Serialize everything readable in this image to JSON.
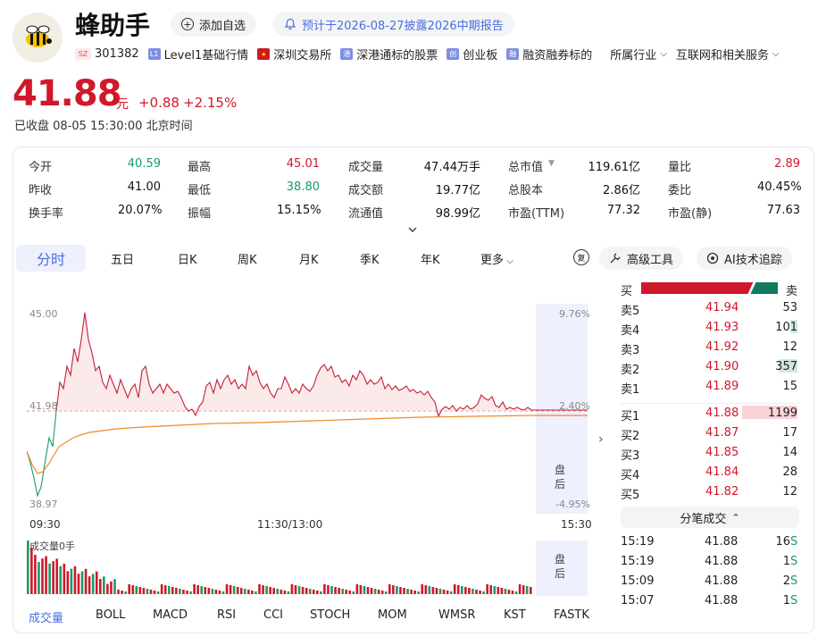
{
  "header": {
    "title": "蜂助手",
    "add_watchlist": "添加自选",
    "notice": "预计于2026-08-27披露2026中期报告"
  },
  "tags": {
    "market_badge": "SZ",
    "code": "301382",
    "l1_badge": "L1",
    "level1": "Level1基础行情",
    "exchange": "深圳交易所",
    "hk_connect_badge": "通",
    "hk_connect": "深港通标的股票",
    "chinext_badge": "创",
    "chinext": "创业板",
    "margin_badge": "融",
    "margin": "融资融券标的",
    "industry_label": "所属行业",
    "industry": "互联网和相关服务"
  },
  "price": {
    "value": "41.88",
    "unit": "元",
    "change": "+0.88",
    "percent": "+2.15%",
    "status": "已收盘",
    "time": "08-05 15:30:00 北京时间"
  },
  "quote": [
    [
      {
        "label": "今开",
        "value": "40.59",
        "color": "green"
      },
      {
        "label": "最高",
        "value": "45.01",
        "color": "red"
      },
      {
        "label": "成交量",
        "value": "47.44万手",
        "color": "blk"
      },
      {
        "label": "总市值",
        "value": "119.61亿",
        "color": "blk"
      },
      {
        "label": "量比",
        "value": "2.89",
        "color": "red"
      }
    ],
    [
      {
        "label": "昨收",
        "value": "41.00",
        "color": "blk"
      },
      {
        "label": "最低",
        "value": "38.80",
        "color": "green"
      },
      {
        "label": "成交额",
        "value": "19.77亿",
        "color": "blk"
      },
      {
        "label": "总股本",
        "value": "2.86亿",
        "color": "blk"
      },
      {
        "label": "委比",
        "value": "40.45%",
        "color": "blk"
      }
    ],
    [
      {
        "label": "换手率",
        "value": "20.07%",
        "color": "blk"
      },
      {
        "label": "振幅",
        "value": "15.15%",
        "color": "blk"
      },
      {
        "label": "流通值",
        "value": "98.99亿",
        "color": "blk"
      },
      {
        "label": "市盈(TTM)",
        "value": "77.32",
        "color": "blk"
      },
      {
        "label": "市盈(静)",
        "value": "77.63",
        "color": "blk"
      }
    ]
  ],
  "tabs": [
    "分时",
    "五日",
    "日K",
    "周K",
    "月K",
    "季K",
    "年K",
    "更多"
  ],
  "tools": {
    "advanced": "高级工具",
    "ai": "AI技术追踪"
  },
  "chart": {
    "y_top": "45.00",
    "y_mid": "41.98",
    "y_bot": "38.97",
    "pct_top": "9.76%",
    "pct_mid": "2.40%",
    "pct_bot": "-4.95%",
    "x_start": "09:30",
    "x_mid": "11:30/13:00",
    "x_end": "15:30",
    "after_hours": "盘后",
    "vol_label": "成交量0手"
  },
  "chart_data": {
    "type": "line",
    "x": [
      "09:30",
      "11:30/13:00",
      "15:30"
    ],
    "series": [],
    "ylim": [
      38.97,
      45.0
    ],
    "y_pct_range": [
      "-4.95%",
      "9.76%"
    ]
  },
  "indicators": [
    "成交量",
    "BOLL",
    "MACD",
    "RSI",
    "CCI",
    "STOCH",
    "MOM",
    "WMSR",
    "KST",
    "FASTK"
  ],
  "orderbook": {
    "buy_label": "买",
    "sell_label": "卖",
    "buy_ratio": 0.8,
    "asks": [
      {
        "label": "卖5",
        "price": "41.94",
        "vol": "53"
      },
      {
        "label": "卖4",
        "price": "41.93",
        "vol": "101"
      },
      {
        "label": "卖3",
        "price": "41.92",
        "vol": "12"
      },
      {
        "label": "卖2",
        "price": "41.90",
        "vol": "357"
      },
      {
        "label": "卖1",
        "price": "41.89",
        "vol": "15"
      }
    ],
    "bids": [
      {
        "label": "买1",
        "price": "41.88",
        "vol": "1199"
      },
      {
        "label": "买2",
        "price": "41.87",
        "vol": "17"
      },
      {
        "label": "买3",
        "price": "41.85",
        "vol": "14"
      },
      {
        "label": "买4",
        "price": "41.84",
        "vol": "28"
      },
      {
        "label": "买5",
        "price": "41.82",
        "vol": "12"
      }
    ]
  },
  "trades": {
    "title": "分笔成交",
    "rows": [
      {
        "time": "15:19",
        "price": "41.88",
        "vol": "16",
        "side": "S"
      },
      {
        "time": "15:19",
        "price": "41.88",
        "vol": "1",
        "side": "S"
      },
      {
        "time": "15:09",
        "price": "41.88",
        "vol": "2",
        "side": "S"
      },
      {
        "time": "15:07",
        "price": "41.88",
        "vol": "1",
        "side": "S"
      }
    ]
  },
  "colors": {
    "up": "#d0182a",
    "down": "#1a9a6a",
    "accent": "#4a6ee0",
    "avg_line": "#f08a2c"
  }
}
